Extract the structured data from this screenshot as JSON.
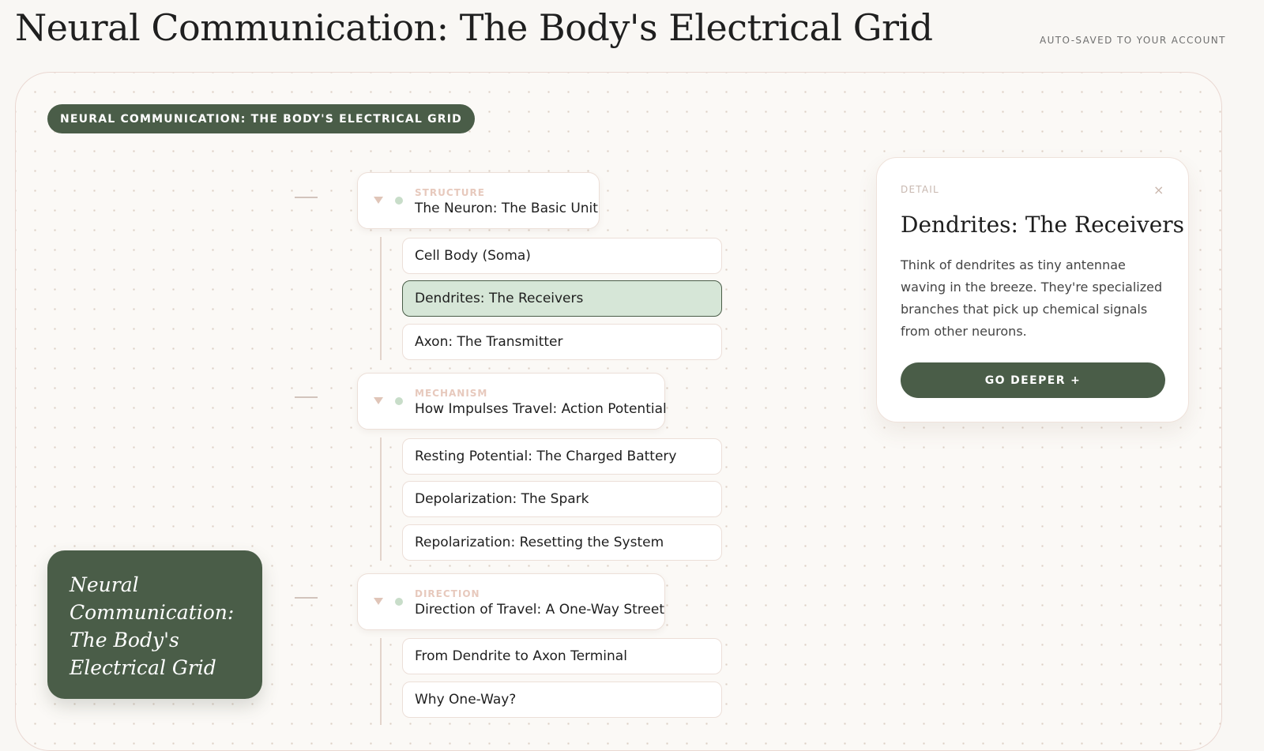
{
  "header": {
    "title": "Neural Communication: The Body's Electrical Grid",
    "status": "AUTO-SAVED TO YOUR ACCOUNT"
  },
  "map": {
    "pill": "NEURAL COMMUNICATION: THE BODY'S ELECTRICAL GRID",
    "root": {
      "line1": "Neural",
      "line2": "Communication:",
      "line3": "The Body's",
      "line4": "Electrical Grid"
    },
    "groups": [
      {
        "kicker": "STRUCTURE",
        "title": "The Neuron: The Basic Unit",
        "children": [
          "Cell Body (Soma)",
          "Dendrites: The Receivers",
          "Axon: The Transmitter"
        ]
      },
      {
        "kicker": "MECHANISM",
        "title": "How Impulses Travel: Action Potential",
        "children": [
          "Resting Potential: The Charged Battery",
          "Depolarization: The Spark",
          "Repolarization: Resetting the System"
        ]
      },
      {
        "kicker": "DIRECTION",
        "title": "Direction of Travel: A One-Way Street",
        "children": [
          "From Dendrite to Axon Terminal",
          "Why One-Way?"
        ]
      }
    ]
  },
  "detail": {
    "label": "DETAIL",
    "close": "×",
    "title": "Dendrites: The Receivers",
    "body": "Think of dendrites as tiny antennae waving in the breeze. They're specialized branches that pick up chemical signals from other neurons.",
    "button": "GO DEEPER +"
  },
  "colors": {
    "accent": "#4a5d48",
    "active_fill": "#d6e6d7",
    "kicker": "#e7c9bd",
    "background": "#f9f7f4"
  }
}
